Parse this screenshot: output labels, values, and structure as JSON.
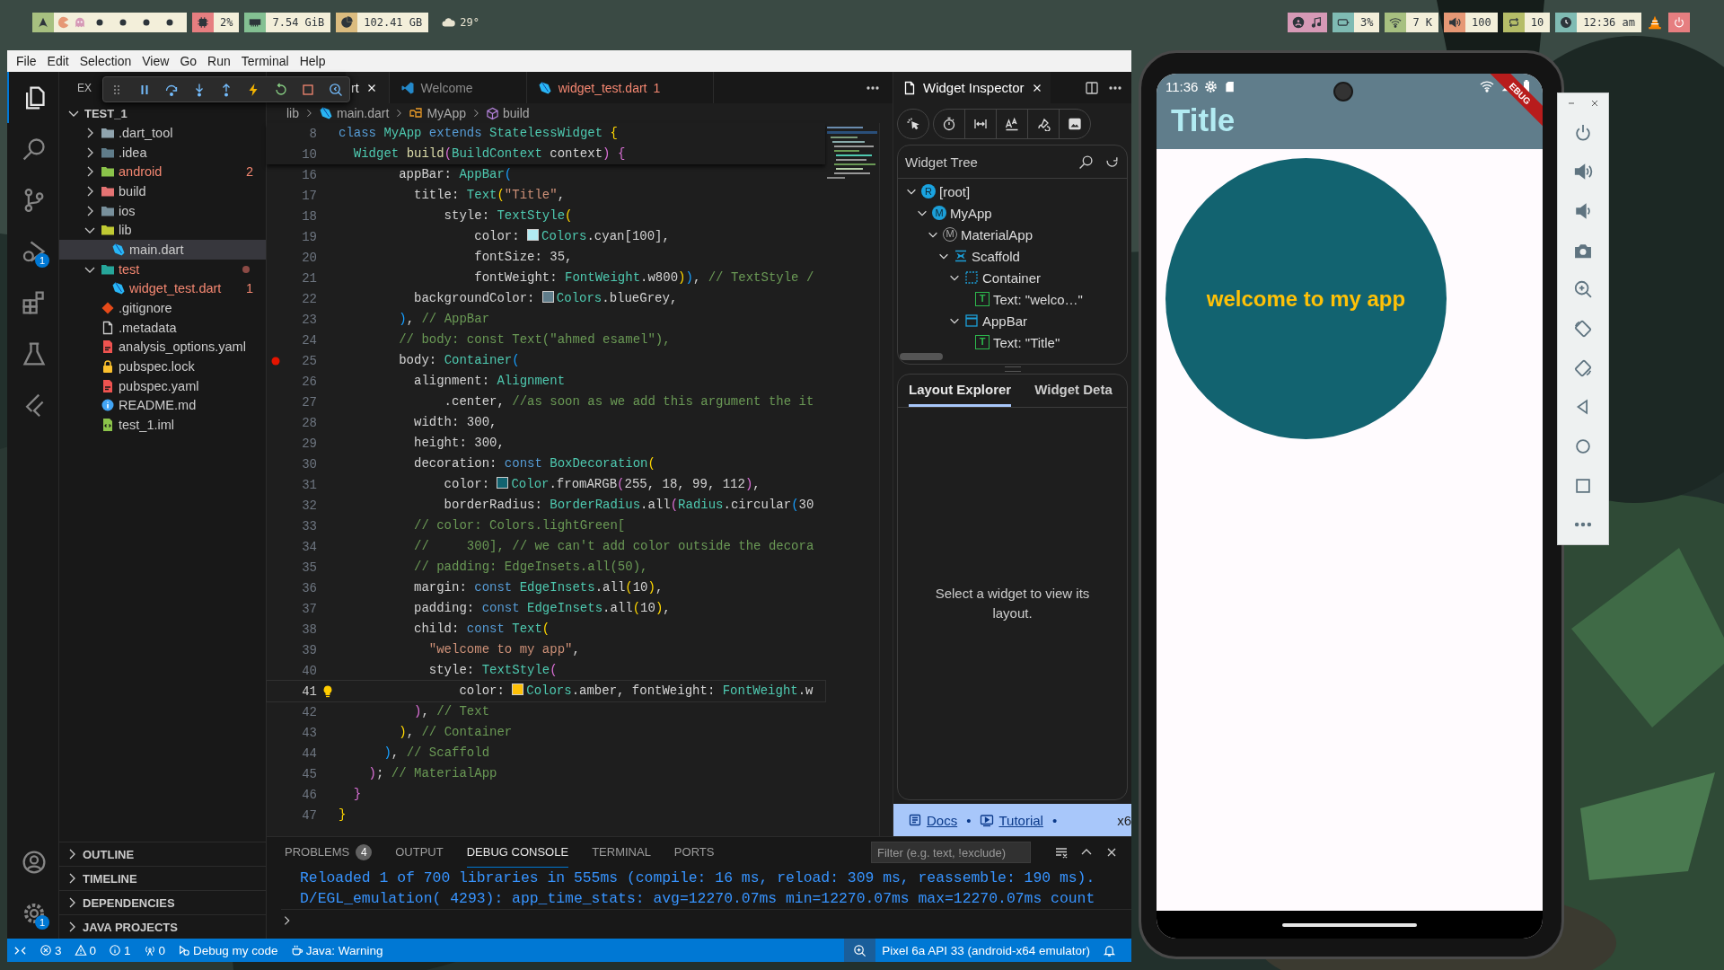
{
  "top_bar": {
    "left_modules": [
      {
        "kind": "cpu",
        "text": "2%",
        "color": "#e67e80"
      },
      {
        "kind": "ram",
        "text": "7.54 GiB",
        "color": "#83c092"
      },
      {
        "kind": "disk",
        "text": "102.41 GB",
        "color": "#dbbc7f"
      }
    ],
    "weather": "29°",
    "right_modules": [
      {
        "kind": "battery",
        "text": "3%",
        "color": "#7fbbb3"
      },
      {
        "kind": "wifi",
        "text": "7 K",
        "color": "#a7c080"
      },
      {
        "kind": "volume",
        "text": "100",
        "color": "#e69875"
      },
      {
        "kind": "updates",
        "text": "10",
        "color": "#b5bd68"
      },
      {
        "kind": "clock",
        "text": "12:36 am",
        "color": "#7fbbb3"
      }
    ]
  },
  "menu": [
    "File",
    "Edit",
    "Selection",
    "View",
    "Go",
    "Run",
    "Terminal",
    "Help"
  ],
  "activity_bar": {
    "top": [
      {
        "kind": "explorer",
        "selected": true
      },
      {
        "kind": "search",
        "selected": false
      },
      {
        "kind": "source-control",
        "selected": false
      },
      {
        "kind": "run-debug",
        "selected": false,
        "badge": "1"
      },
      {
        "kind": "extensions",
        "selected": false
      },
      {
        "kind": "testing",
        "selected": false
      },
      {
        "kind": "flutter",
        "selected": false
      }
    ],
    "bottom": [
      {
        "kind": "accounts",
        "selected": false
      },
      {
        "kind": "settings",
        "selected": false,
        "badge": "1"
      }
    ]
  },
  "explorer": {
    "title": "EX",
    "root": {
      "label": "TEST_1",
      "expanded": true
    },
    "items": [
      {
        "label": ".dart_tool",
        "kind": "folder",
        "expanded": false,
        "selected": false,
        "error": false
      },
      {
        "label": ".idea",
        "kind": "folder-idea",
        "expanded": false,
        "selected": false,
        "error": false
      },
      {
        "label": "android",
        "kind": "folder-android",
        "expanded": false,
        "selected": false,
        "error": true,
        "badge": "2"
      },
      {
        "label": "build",
        "kind": "folder-build",
        "expanded": false,
        "selected": false,
        "error": false
      },
      {
        "label": "ios",
        "kind": "folder-ios",
        "expanded": false,
        "selected": false,
        "error": false
      },
      {
        "label": "lib",
        "kind": "folder-lib",
        "expanded": true,
        "selected": false,
        "error": false,
        "children": [
          {
            "label": "main.dart",
            "kind": "dart",
            "selected": true,
            "error": false
          }
        ]
      },
      {
        "label": "test",
        "kind": "folder-test",
        "expanded": true,
        "selected": false,
        "error": true,
        "dot": true,
        "children": [
          {
            "label": "widget_test.dart",
            "kind": "dart",
            "selected": false,
            "error": true,
            "badge": "1"
          }
        ]
      },
      {
        "label": ".gitignore",
        "kind": "git",
        "selected": false,
        "error": false
      },
      {
        "label": ".metadata",
        "kind": "file",
        "selected": false,
        "error": false
      },
      {
        "label": "analysis_options.yaml",
        "kind": "yaml",
        "selected": false,
        "error": false
      },
      {
        "label": "pubspec.lock",
        "kind": "lock",
        "selected": false,
        "error": false
      },
      {
        "label": "pubspec.yaml",
        "kind": "yaml",
        "selected": false,
        "error": false
      },
      {
        "label": "README.md",
        "kind": "info",
        "selected": false,
        "error": false
      },
      {
        "label": "test_1.iml",
        "kind": "iml",
        "selected": false,
        "error": false
      }
    ],
    "sections": [
      {
        "label": "OUTLINE",
        "expanded": false
      },
      {
        "label": "TIMELINE",
        "expanded": false
      },
      {
        "label": "DEPENDENCIES",
        "expanded": false
      },
      {
        "label": "JAVA PROJECTS",
        "expanded": false
      }
    ]
  },
  "editor": {
    "tabs": [
      {
        "label": "rt",
        "kind": "dart",
        "selected": true,
        "error": false
      },
      {
        "label": "Welcome",
        "kind": "vscode",
        "selected": false,
        "error": false
      },
      {
        "label": "widget_test.dart",
        "kind": "dart",
        "selected": false,
        "error": true,
        "badge": "1"
      }
    ],
    "breadcrumb": [
      {
        "label": "lib",
        "kind": "none"
      },
      {
        "label": "main.dart",
        "kind": "dart"
      },
      {
        "label": "MyApp",
        "kind": "class"
      },
      {
        "label": "build",
        "kind": "method"
      }
    ],
    "sticky": [
      {
        "n": "8",
        "tokens": [
          {
            "kind": "kw",
            "text": "class "
          },
          {
            "kind": "ty",
            "text": "MyApp "
          },
          {
            "kind": "kw",
            "text": "extends "
          },
          {
            "kind": "ty",
            "text": "StatelessWidget "
          },
          {
            "kind": "b1",
            "text": "{"
          }
        ]
      },
      {
        "n": "10",
        "tokens": [
          {
            "kind": "ty",
            "text": "  Widget "
          },
          {
            "kind": "f",
            "text": "build"
          },
          {
            "kind": "b2",
            "text": "("
          },
          {
            "kind": "ty",
            "text": "BuildContext "
          },
          {
            "kind": "p",
            "text": "context"
          },
          {
            "kind": "b2",
            "text": ")"
          },
          {
            "kind": "b2",
            "text": " {"
          }
        ]
      }
    ],
    "lines": [
      {
        "n": "16",
        "tokens": [
          {
            "kind": "p",
            "text": "        appBar: "
          },
          {
            "kind": "ty",
            "text": "AppBar"
          },
          {
            "kind": "b3",
            "text": "("
          }
        ]
      },
      {
        "n": "17",
        "tokens": [
          {
            "kind": "p",
            "text": "          title: "
          },
          {
            "kind": "ty",
            "text": "Text"
          },
          {
            "kind": "b1",
            "text": "("
          },
          {
            "kind": "s",
            "text": "\"Title\""
          },
          {
            "kind": "p",
            "text": ","
          }
        ]
      },
      {
        "n": "18",
        "tokens": [
          {
            "kind": "p",
            "text": "              style: "
          },
          {
            "kind": "ty",
            "text": "TextStyle"
          },
          {
            "kind": "b1",
            "text": "("
          }
        ]
      },
      {
        "n": "19",
        "tokens": [
          {
            "kind": "p",
            "text": "                  color: "
          },
          {
            "kind": "swatch",
            "color": "#b2ebf2"
          },
          {
            "kind": "ty",
            "text": "Colors"
          },
          {
            "kind": "p",
            "text": ".cyan[100],"
          }
        ]
      },
      {
        "n": "20",
        "tokens": [
          {
            "kind": "p",
            "text": "                  fontSize: 35,"
          }
        ]
      },
      {
        "n": "21",
        "tokens": [
          {
            "kind": "p",
            "text": "                  fontWeight: "
          },
          {
            "kind": "ty",
            "text": "FontWeight"
          },
          {
            "kind": "p",
            "text": ".w800"
          },
          {
            "kind": "b1",
            "text": ")"
          },
          {
            "kind": "b3",
            "text": ")"
          },
          {
            "kind": "p",
            "text": ", "
          },
          {
            "kind": "c",
            "text": "// TextStyle /"
          }
        ]
      },
      {
        "n": "22",
        "tokens": [
          {
            "kind": "p",
            "text": "          backgroundColor: "
          },
          {
            "kind": "swatch",
            "color": "#607d8b"
          },
          {
            "kind": "ty",
            "text": "Colors"
          },
          {
            "kind": "p",
            "text": ".blueGrey,"
          }
        ]
      },
      {
        "n": "23",
        "tokens": [
          {
            "kind": "b3",
            "text": "        )"
          },
          {
            "kind": "p",
            "text": ", "
          },
          {
            "kind": "c",
            "text": "// AppBar"
          }
        ]
      },
      {
        "n": "24",
        "tokens": [
          {
            "kind": "c",
            "text": "        // body: const Text(\"ahmed esamel\"),"
          }
        ]
      },
      {
        "n": "25",
        "breakpoint": true,
        "tokens": [
          {
            "kind": "p",
            "text": "        body: "
          },
          {
            "kind": "ty",
            "text": "Container"
          },
          {
            "kind": "b3",
            "text": "("
          }
        ]
      },
      {
        "n": "26",
        "tokens": [
          {
            "kind": "p",
            "text": "          alignment: "
          },
          {
            "kind": "ty",
            "text": "Alignment"
          }
        ]
      },
      {
        "n": "27",
        "tokens": [
          {
            "kind": "p",
            "text": "              .center, "
          },
          {
            "kind": "c",
            "text": "//as soon as we add this argument the it"
          }
        ]
      },
      {
        "n": "28",
        "tokens": [
          {
            "kind": "p",
            "text": "          width: 300,"
          }
        ]
      },
      {
        "n": "29",
        "tokens": [
          {
            "kind": "p",
            "text": "          height: 300,"
          }
        ]
      },
      {
        "n": "30",
        "tokens": [
          {
            "kind": "p",
            "text": "          decoration: "
          },
          {
            "kind": "kw",
            "text": "const "
          },
          {
            "kind": "ty",
            "text": "BoxDecoration"
          },
          {
            "kind": "b1",
            "text": "("
          }
        ]
      },
      {
        "n": "31",
        "tokens": [
          {
            "kind": "p",
            "text": "              color: "
          },
          {
            "kind": "swatch",
            "color": "#126370"
          },
          {
            "kind": "ty",
            "text": "Color"
          },
          {
            "kind": "p",
            "text": ".fromARGB"
          },
          {
            "kind": "b2",
            "text": "("
          },
          {
            "kind": "p",
            "text": "255, 18, 99, 112"
          },
          {
            "kind": "b2",
            "text": ")"
          },
          {
            "kind": "p",
            "text": ","
          }
        ]
      },
      {
        "n": "32",
        "tokens": [
          {
            "kind": "p",
            "text": "              borderRadius: "
          },
          {
            "kind": "ty",
            "text": "BorderRadius"
          },
          {
            "kind": "p",
            "text": ".all"
          },
          {
            "kind": "b2",
            "text": "("
          },
          {
            "kind": "ty",
            "text": "Radius"
          },
          {
            "kind": "p",
            "text": ".circular"
          },
          {
            "kind": "b3",
            "text": "("
          },
          {
            "kind": "p",
            "text": "30"
          }
        ]
      },
      {
        "n": "33",
        "tokens": [
          {
            "kind": "c",
            "text": "          // color: Colors.lightGreen["
          }
        ]
      },
      {
        "n": "34",
        "tokens": [
          {
            "kind": "c",
            "text": "          //     300], // we can't add color outside the decora"
          }
        ]
      },
      {
        "n": "35",
        "tokens": [
          {
            "kind": "c",
            "text": "          // padding: EdgeInsets.all(50),"
          }
        ]
      },
      {
        "n": "36",
        "tokens": [
          {
            "kind": "p",
            "text": "          margin: "
          },
          {
            "kind": "kw",
            "text": "const "
          },
          {
            "kind": "ty",
            "text": "EdgeInsets"
          },
          {
            "kind": "p",
            "text": ".all"
          },
          {
            "kind": "b1",
            "text": "("
          },
          {
            "kind": "p",
            "text": "10"
          },
          {
            "kind": "b1",
            "text": ")"
          },
          {
            "kind": "p",
            "text": ","
          }
        ]
      },
      {
        "n": "37",
        "tokens": [
          {
            "kind": "p",
            "text": "          padding: "
          },
          {
            "kind": "kw",
            "text": "const "
          },
          {
            "kind": "ty",
            "text": "EdgeInsets"
          },
          {
            "kind": "p",
            "text": ".all"
          },
          {
            "kind": "b1",
            "text": "("
          },
          {
            "kind": "p",
            "text": "10"
          },
          {
            "kind": "b1",
            "text": ")"
          },
          {
            "kind": "p",
            "text": ","
          }
        ]
      },
      {
        "n": "38",
        "tokens": [
          {
            "kind": "p",
            "text": "          child: "
          },
          {
            "kind": "kw",
            "text": "const "
          },
          {
            "kind": "ty",
            "text": "Text"
          },
          {
            "kind": "b1",
            "text": "("
          }
        ]
      },
      {
        "n": "39",
        "tokens": [
          {
            "kind": "s",
            "text": "            \"welcome to my app\""
          },
          {
            "kind": "p",
            "text": ","
          }
        ]
      },
      {
        "n": "40",
        "tokens": [
          {
            "kind": "p",
            "text": "            style: "
          },
          {
            "kind": "ty",
            "text": "TextStyle"
          },
          {
            "kind": "b2",
            "text": "("
          }
        ]
      },
      {
        "n": "41",
        "lightbulb": true,
        "active": true,
        "tokens": [
          {
            "kind": "p",
            "text": "                color: "
          },
          {
            "kind": "swatch",
            "color": "#ffc107"
          },
          {
            "kind": "ty",
            "text": "Colors"
          },
          {
            "kind": "p",
            "text": ".amber, fontWeight: "
          },
          {
            "kind": "ty",
            "text": "FontWeight"
          },
          {
            "kind": "p",
            "text": ".w"
          }
        ]
      },
      {
        "n": "42",
        "tokens": [
          {
            "kind": "b2",
            "text": "          )"
          },
          {
            "kind": "p",
            "text": ", "
          },
          {
            "kind": "c",
            "text": "// Text"
          }
        ]
      },
      {
        "n": "43",
        "tokens": [
          {
            "kind": "b1",
            "text": "        )"
          },
          {
            "kind": "p",
            "text": ", "
          },
          {
            "kind": "c",
            "text": "// Container"
          }
        ]
      },
      {
        "n": "44",
        "tokens": [
          {
            "kind": "b3",
            "text": "      )"
          },
          {
            "kind": "p",
            "text": ", "
          },
          {
            "kind": "c",
            "text": "// Scaffold"
          }
        ]
      },
      {
        "n": "45",
        "tokens": [
          {
            "kind": "b2",
            "text": "    )"
          },
          {
            "kind": "p",
            "text": "; "
          },
          {
            "kind": "c",
            "text": "// MaterialApp"
          }
        ]
      },
      {
        "n": "46",
        "tokens": [
          {
            "kind": "b2",
            "text": "  }"
          }
        ]
      },
      {
        "n": "47",
        "tokens": [
          {
            "kind": "b1",
            "text": "}"
          }
        ]
      }
    ]
  },
  "inspector": {
    "tab": "Widget Inspector",
    "tree_title": "Widget Tree",
    "tree": [
      {
        "label": "[root]",
        "kind": "root",
        "badge": "R",
        "expanded": true,
        "children": [
          {
            "label": "MyApp",
            "kind": "app",
            "badge": "M",
            "expanded": true,
            "children": [
              {
                "label": "MaterialApp",
                "kind": "material",
                "badge": "M",
                "expanded": true,
                "children": [
                  {
                    "label": "Scaffold",
                    "kind": "scaffold",
                    "expanded": true,
                    "children": [
                      {
                        "label": "Container",
                        "kind": "container",
                        "expanded": true,
                        "children": [
                          {
                            "label": "Text: \"welco…\"",
                            "kind": "text",
                            "badge": "T"
                          }
                        ]
                      },
                      {
                        "label": "AppBar",
                        "kind": "appbar",
                        "expanded": true,
                        "children": [
                          {
                            "label": "Text: \"Title\"",
                            "kind": "text",
                            "badge": "T"
                          }
                        ]
                      }
                    ]
                  }
                ]
              }
            ]
          }
        ]
      }
    ],
    "tabs": [
      {
        "label": "Layout Explorer",
        "selected": true
      },
      {
        "label": "Widget Deta",
        "selected": false
      }
    ],
    "message": "Select a widget to view its layout.",
    "footer": [
      {
        "kind": "docs",
        "label": "Docs"
      },
      {
        "kind": "dot",
        "label": "•"
      },
      {
        "kind": "tutorial",
        "label": "Tutorial"
      },
      {
        "kind": "dot",
        "label": "•"
      },
      {
        "kind": "text",
        "label": "x6"
      }
    ]
  },
  "panel": {
    "tabs": [
      {
        "label": "PROBLEMS",
        "badge": "4",
        "selected": false
      },
      {
        "label": "OUTPUT",
        "selected": false
      },
      {
        "label": "DEBUG CONSOLE",
        "selected": true
      },
      {
        "label": "TERMINAL",
        "selected": false
      },
      {
        "label": "PORTS",
        "selected": false
      }
    ],
    "filter": {
      "placeholder": "Filter (e.g. text, !exclude)"
    },
    "console": [
      "Reloaded 1 of 700 libraries in 555ms (compile: 16 ms, reload: 309 ms, reassemble: 190 ms).",
      "D/EGL_emulation( 4293): app_time_stats: avg=12270.07ms min=12270.07ms max=12270.07ms count"
    ]
  },
  "status_bar": {
    "left": [
      {
        "kind": "remote"
      },
      {
        "kind": "errors",
        "text": "3"
      },
      {
        "kind": "warnings",
        "text": "0"
      },
      {
        "kind": "infos",
        "text": "1"
      },
      {
        "kind": "ports",
        "text": "0"
      },
      {
        "kind": "debug",
        "text": "Debug my code"
      },
      {
        "kind": "java",
        "text": "Java: Warning"
      }
    ],
    "right": [
      {
        "kind": "zoom"
      },
      {
        "kind": "device",
        "text": "Pixel 6a API 33 (android-x64 emulator)"
      },
      {
        "kind": "bell"
      }
    ]
  },
  "phone": {
    "time": "11:36",
    "banner": "EBUG",
    "title": "Title",
    "body_text": "welcome to my app"
  }
}
